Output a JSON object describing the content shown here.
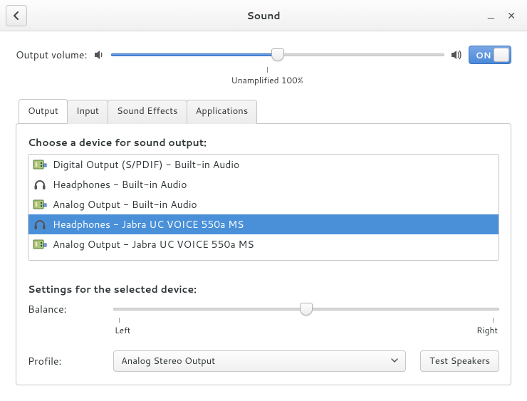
{
  "window": {
    "title": "Sound"
  },
  "volume": {
    "label": "Output volume:",
    "percent": 50,
    "tick_label": "Unamplified  100%",
    "toggle_label": "ON"
  },
  "tabs": [
    {
      "label": "Output"
    },
    {
      "label": "Input"
    },
    {
      "label": "Sound Effects"
    },
    {
      "label": "Applications"
    }
  ],
  "output": {
    "choose_label": "Choose a device for sound output:",
    "devices": [
      {
        "icon": "card",
        "label": "Digital Output (S/PDIF) - Built-in Audio",
        "selected": false
      },
      {
        "icon": "headphones",
        "label": "Headphones - Built-in Audio",
        "selected": false
      },
      {
        "icon": "card",
        "label": "Analog Output - Built-in Audio",
        "selected": false
      },
      {
        "icon": "headphones",
        "label": "Headphones - Jabra UC VOICE 550a MS",
        "selected": true
      },
      {
        "icon": "card",
        "label": "Analog Output - Jabra UC VOICE 550a MS",
        "selected": false
      }
    ],
    "settings_label": "Settings for the selected device:",
    "balance": {
      "label": "Balance:",
      "left": "Left",
      "right": "Right",
      "value": 50
    },
    "profile": {
      "label": "Profile:",
      "selected": "Analog Stereo Output",
      "test_button": "Test Speakers"
    }
  }
}
